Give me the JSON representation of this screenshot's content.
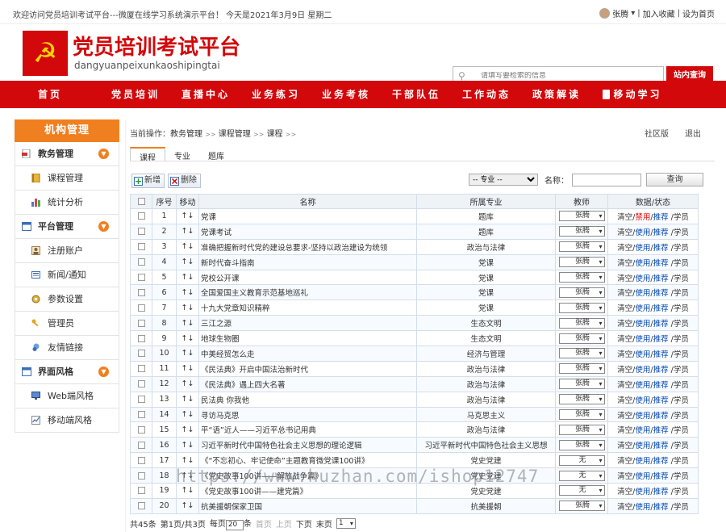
{
  "topbar": {
    "welcome": "欢迎访问党员培训考试平台---微厦在线学习系统演示平台！ 今天是2021年3月9日 星期二",
    "user": "张腾",
    "add_favorite": "加入收藏",
    "set_home": "设为首页"
  },
  "header": {
    "logo_glyph": "☭",
    "title": "党员培训考试平台",
    "subtitle": "dangyuanpeixunkaoshipingtai",
    "search_placeholder": "请填写要检索的信息",
    "search_button": "站内查询",
    "brand_color": "#d2080b"
  },
  "nav": {
    "items": [
      "首页",
      "党员培训",
      "直播中心",
      "业务练习",
      "业务考核",
      "干部队伍",
      "工作动态",
      "政策解读",
      "移动学习"
    ]
  },
  "sidebar": {
    "title": "机构管理",
    "accent": "#f07f1f",
    "groups": [
      {
        "label": "教务管理",
        "items": [
          "课程管理",
          "统计分析"
        ]
      },
      {
        "label": "平台管理",
        "items": [
          "注册账户",
          "新闻/通知",
          "参数设置",
          "管理员",
          "友情链接"
        ]
      },
      {
        "label": "界面风格",
        "items": [
          "Web端风格",
          "移动端风格"
        ]
      }
    ]
  },
  "main": {
    "breadcrumb": {
      "prefix": "当前操作：",
      "items": [
        "教务管理",
        "课程管理",
        "课程"
      ],
      "sep": ">>"
    },
    "community": "社区版",
    "logout": "退出",
    "tabs": [
      "课程",
      "专业",
      "题库"
    ],
    "toolbar": {
      "add": "新增",
      "delete": "删除"
    },
    "filter": {
      "major_select": "-- 专业 --",
      "name_label": "名称：",
      "query_button": "查询"
    },
    "table": {
      "headers": [
        "",
        "序号",
        "移动",
        "名称",
        "所属专业",
        "教师",
        "数据/状态"
      ],
      "move_glyph": "↑↓",
      "rows": [
        {
          "no": "1",
          "name": "党课",
          "major": "题库",
          "teacher": "张腾",
          "status": "禁用"
        },
        {
          "no": "2",
          "name": "党课考试",
          "major": "题库",
          "teacher": "张腾",
          "status": "使用"
        },
        {
          "no": "3",
          "name": "准确把握新时代党的建设总要求-坚持以政治建设为统领",
          "major": "政治与法律",
          "teacher": "张腾",
          "status": "使用"
        },
        {
          "no": "4",
          "name": "新时代奋斗指南",
          "major": "党课",
          "teacher": "张腾",
          "status": "使用"
        },
        {
          "no": "5",
          "name": "党校公开课",
          "major": "党课",
          "teacher": "张腾",
          "status": "使用"
        },
        {
          "no": "6",
          "name": "全国爱国主义教育示范基地巡礼",
          "major": "党课",
          "teacher": "张腾",
          "status": "使用"
        },
        {
          "no": "7",
          "name": "十九大党章知识精粹",
          "major": "党课",
          "teacher": "张腾",
          "status": "使用"
        },
        {
          "no": "8",
          "name": "三江之源",
          "major": "生态文明",
          "teacher": "张腾",
          "status": "使用"
        },
        {
          "no": "9",
          "name": "地球生物圈",
          "major": "生态文明",
          "teacher": "张腾",
          "status": "使用"
        },
        {
          "no": "10",
          "name": "中美经贸怎么走",
          "major": "经济与管理",
          "teacher": "张腾",
          "status": "使用"
        },
        {
          "no": "11",
          "name": "《民法典》开启中国法治新时代",
          "major": "政治与法律",
          "teacher": "张腾",
          "status": "使用"
        },
        {
          "no": "12",
          "name": "《民法典》遇上四大名著",
          "major": "政治与法律",
          "teacher": "张腾",
          "status": "使用"
        },
        {
          "no": "13",
          "name": "民法典 你我他",
          "major": "政治与法律",
          "teacher": "张腾",
          "status": "使用"
        },
        {
          "no": "14",
          "name": "寻访马克思",
          "major": "马克思主义",
          "teacher": "张腾",
          "status": "使用"
        },
        {
          "no": "15",
          "name": "平“语”近人——习近平总书记用典",
          "major": "政治与法律",
          "teacher": "张腾",
          "status": "使用"
        },
        {
          "no": "16",
          "name": "习近平新时代中国特色社会主义思想的理论逻辑",
          "major": "习近平新时代中国特色社会主义思想",
          "teacher": "张腾",
          "status": "使用"
        },
        {
          "no": "17",
          "name": "《“不忘初心、牢记使命”主题教育微党课100讲》",
          "major": "党史党建",
          "teacher": "无",
          "status": "使用"
        },
        {
          "no": "18",
          "name": "《党史故事100讲——解放战争篇》",
          "major": "党史党建",
          "teacher": "无",
          "status": "使用"
        },
        {
          "no": "19",
          "name": "《党史故事100讲——建党篇》",
          "major": "党史党建",
          "teacher": "无",
          "status": "使用"
        },
        {
          "no": "20",
          "name": "抗美援朝保家卫国",
          "major": "抗美援朝",
          "teacher": "张腾",
          "status": "使用"
        }
      ],
      "actions": {
        "clear": "清空",
        "recommend": "推荐",
        "students": "学员"
      }
    },
    "pager": {
      "total": "共45条",
      "page": "第1页/共3页",
      "per_page_prefix": "每页",
      "per_page": "20",
      "per_page_suffix": "条",
      "first": "首页",
      "prev": "上页",
      "next": "下页",
      "last": "末页",
      "select": "1"
    }
  },
  "watermark": "https://www.huzhan.com/ishop12747"
}
